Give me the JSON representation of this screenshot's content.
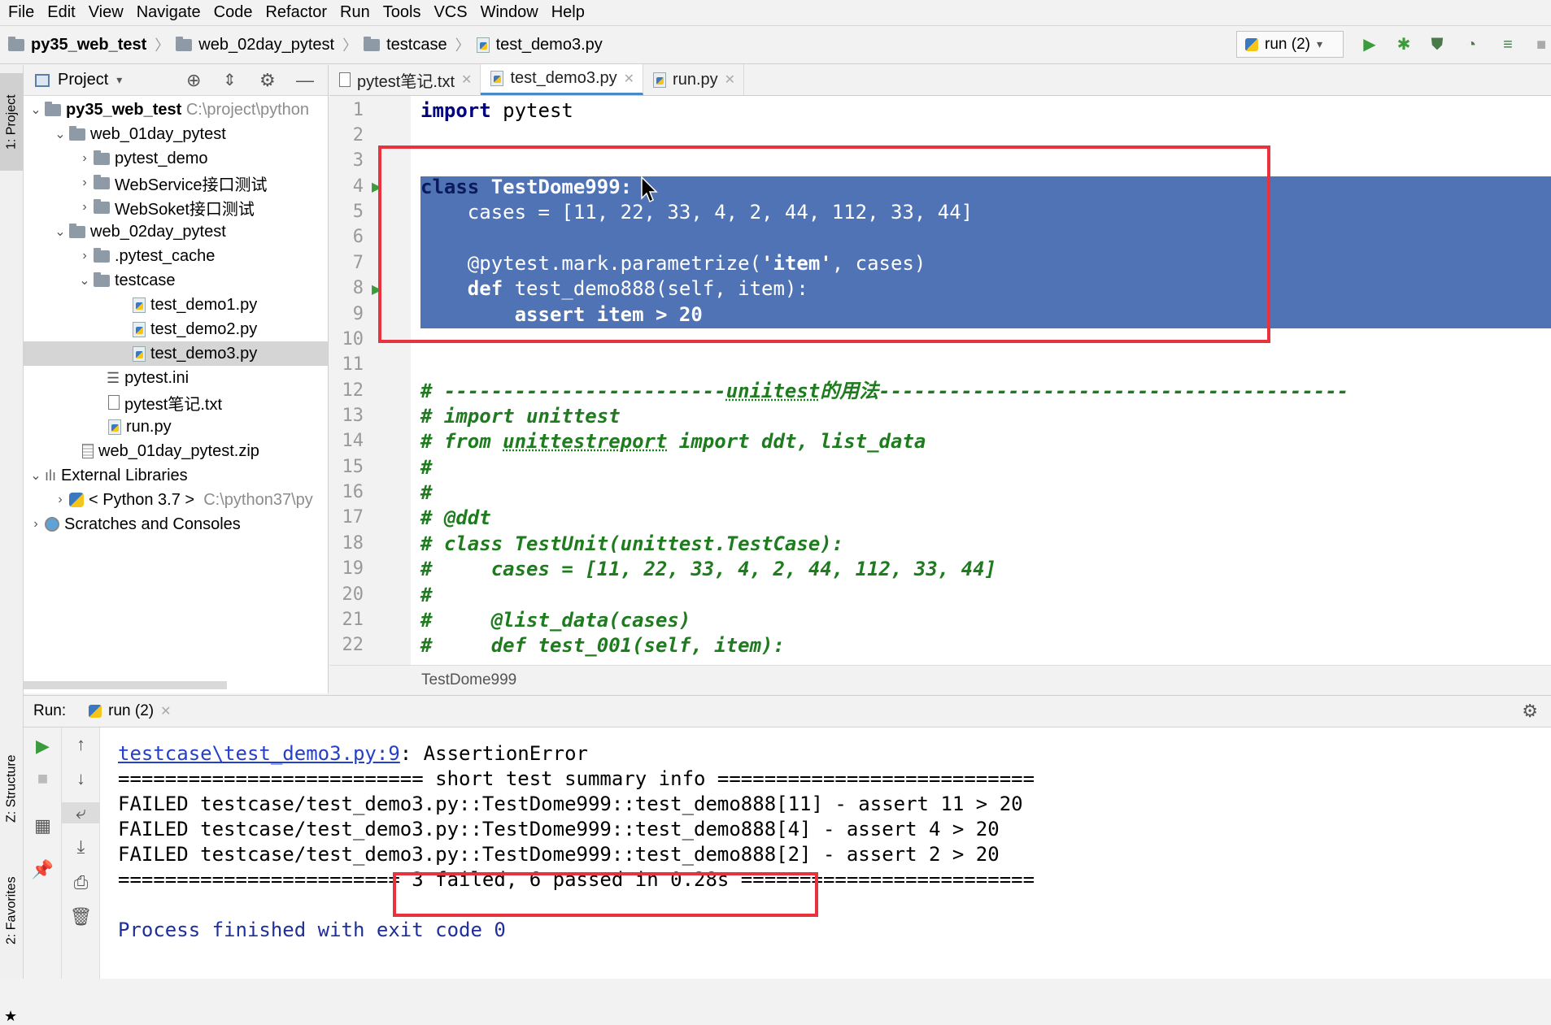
{
  "menu": [
    "File",
    "Edit",
    "View",
    "Navigate",
    "Code",
    "Refactor",
    "Run",
    "Tools",
    "VCS",
    "Window",
    "Help"
  ],
  "breadcrumb": [
    "py35_web_test",
    "web_02day_pytest",
    "testcase",
    "test_demo3.py"
  ],
  "run_config": "run (2)",
  "side_tabs": {
    "project": "1: Project",
    "structure": "Z: Structure",
    "favorites": "2: Favorites"
  },
  "project_panel": {
    "title": "Project",
    "tree": [
      {
        "label": "py35_web_test",
        "path": "C:\\project\\python",
        "bold": true
      },
      {
        "label": "web_01day_pytest"
      },
      {
        "label": "pytest_demo"
      },
      {
        "label": "WebService接口测试"
      },
      {
        "label": "WebSoket接口测试"
      },
      {
        "label": "web_02day_pytest"
      },
      {
        "label": ".pytest_cache"
      },
      {
        "label": "testcase"
      },
      {
        "label": "test_demo1.py"
      },
      {
        "label": "test_demo2.py"
      },
      {
        "label": "test_demo3.py",
        "selected": true
      },
      {
        "label": "pytest.ini"
      },
      {
        "label": "pytest笔记.txt"
      },
      {
        "label": "run.py"
      },
      {
        "label": "web_01day_pytest.zip"
      },
      {
        "label": "External Libraries"
      },
      {
        "label": "< Python 3.7 >",
        "path": "C:\\python37\\py"
      },
      {
        "label": "Scratches and Consoles"
      }
    ]
  },
  "editor": {
    "tabs": [
      "pytest笔记.txt",
      "test_demo3.py",
      "run.py"
    ],
    "active_tab": "test_demo3.py",
    "line_numbers": [
      "1",
      "2",
      "3",
      "4",
      "5",
      "6",
      "7",
      "8",
      "9",
      "10",
      "11",
      "12",
      "13",
      "14",
      "15",
      "16",
      "17",
      "18",
      "19",
      "20",
      "21",
      "22"
    ],
    "lines": {
      "l1_kw": "import",
      "l1_rest": " pytest",
      "l4_kw": "class",
      "l4_rest": " TestDome999:",
      "l5": "    cases = [11, 22, 33, 4, 2, 44, 112, 33, 44]",
      "l7_a": "    @pytest.mark.parametrize(",
      "l7_str": "'item'",
      "l7_b": ", cases)",
      "l8_kw": "    def",
      "l8_rest": " test_demo888(self, item):",
      "l9_kw": "        assert",
      "l9_rest": " item > 20",
      "l12_a": "# ------------------------",
      "l12_u": "uniitest",
      "l12_b": "的用法----------------------------------------",
      "l13": "# import unittest",
      "l14_a": "# from ",
      "l14_u": "unittestreport",
      "l14_b": " import ddt, list_data",
      "l15": "#",
      "l16": "#",
      "l17": "# @ddt",
      "l18": "# class TestUnit(unittest.TestCase):",
      "l19": "#     cases = [11, 22, 33, 4, 2, 44, 112, 33, 44]",
      "l20": "#",
      "l21": "#     @list_data(cases)",
      "l22": "#     def test_001(self, item):"
    },
    "breadcrumb": "TestDome999"
  },
  "run_panel": {
    "label": "Run:",
    "tab": "run (2)",
    "output": {
      "link": "testcase\\test_demo3.py:9",
      "err": ": AssertionError",
      "summary": "========================== short test summary info ===========================",
      "f1": "FAILED testcase/test_demo3.py::TestDome999::test_demo888[11] - assert 11 > 20",
      "f2": "FAILED testcase/test_demo3.py::TestDome999::test_demo888[4] - assert 4 > 20",
      "f3": "FAILED testcase/test_demo3.py::TestDome999::test_demo888[2] - assert 2 > 20",
      "result": "======================== 3 failed, 6 passed in 0.28s =========================",
      "exit": "Process finished with exit code 0"
    }
  },
  "colors": {
    "selection": "#4f73b4",
    "highlight_box": "#e8323d",
    "keyword": "#000080",
    "comment": "#1e7b1e"
  }
}
